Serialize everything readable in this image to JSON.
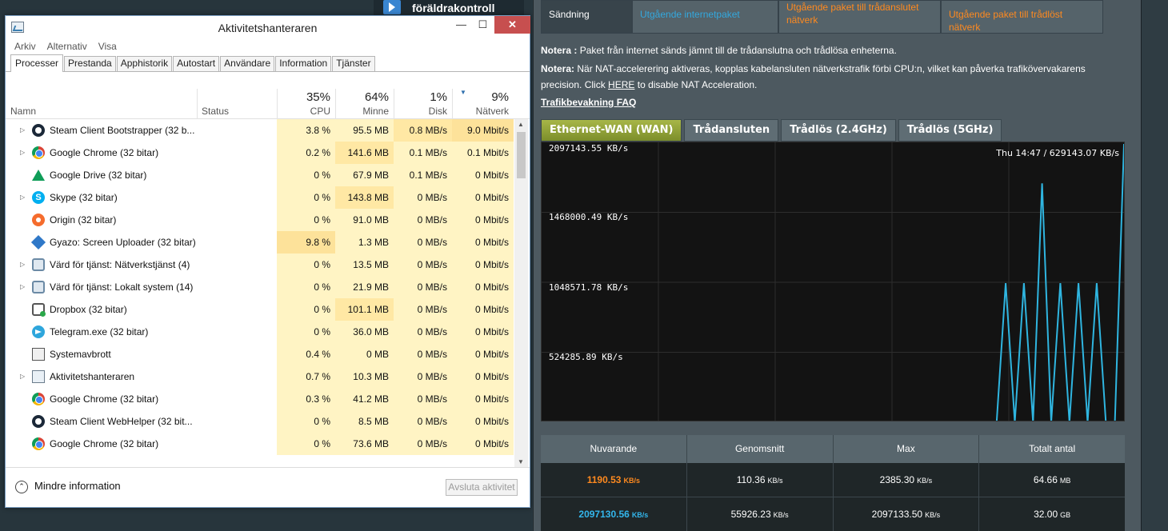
{
  "background_window": {
    "title": "föräldrakontroll"
  },
  "taskmgr": {
    "title": "Aktivitetshanteraren",
    "menu": [
      "Arkiv",
      "Alternativ",
      "Visa"
    ],
    "tabs": [
      "Processer",
      "Prestanda",
      "Apphistorik",
      "Autostart",
      "Användare",
      "Information",
      "Tjänster"
    ],
    "active_tab": "Processer",
    "columns": {
      "name": "Namn",
      "status": "Status",
      "cpu": {
        "pct": "35%",
        "label": "CPU"
      },
      "mem": {
        "pct": "64%",
        "label": "Minne"
      },
      "disk": {
        "pct": "1%",
        "label": "Disk"
      },
      "net": {
        "pct": "9%",
        "label": "Nätverk"
      }
    },
    "rows": [
      {
        "name": "Steam Client Bootstrapper (32 b...",
        "icon": "steam-icon",
        "expand": true,
        "cpu": "3.8 %",
        "mem": "95.5 MB",
        "disk": "0.8 MB/s",
        "net": "9.0 Mbit/s"
      },
      {
        "name": "Google Chrome (32 bitar)",
        "icon": "chrome-icon",
        "expand": true,
        "cpu": "0.2 %",
        "mem": "141.6 MB",
        "disk": "0.1 MB/s",
        "net": "0.1 Mbit/s"
      },
      {
        "name": "Google Drive (32 bitar)",
        "icon": "google-drive-icon",
        "expand": false,
        "cpu": "0 %",
        "mem": "67.9 MB",
        "disk": "0.1 MB/s",
        "net": "0 Mbit/s"
      },
      {
        "name": "Skype (32 bitar)",
        "icon": "skype-icon",
        "expand": true,
        "cpu": "0 %",
        "mem": "143.8 MB",
        "disk": "0 MB/s",
        "net": "0 Mbit/s"
      },
      {
        "name": "Origin (32 bitar)",
        "icon": "origin-icon",
        "expand": false,
        "cpu": "0 %",
        "mem": "91.0 MB",
        "disk": "0 MB/s",
        "net": "0 Mbit/s"
      },
      {
        "name": "Gyazo: Screen Uploader (32 bitar)",
        "icon": "gyazo-icon",
        "expand": false,
        "cpu": "9.8 %",
        "mem": "1.3 MB",
        "disk": "0 MB/s",
        "net": "0 Mbit/s"
      },
      {
        "name": "Värd för tjänst: Nätverkstjänst (4)",
        "icon": "service-host-icon",
        "expand": true,
        "cpu": "0 %",
        "mem": "13.5 MB",
        "disk": "0 MB/s",
        "net": "0 Mbit/s"
      },
      {
        "name": "Värd för tjänst: Lokalt system (14)",
        "icon": "service-host-icon",
        "expand": true,
        "cpu": "0 %",
        "mem": "21.9 MB",
        "disk": "0 MB/s",
        "net": "0 Mbit/s"
      },
      {
        "name": "Dropbox (32 bitar)",
        "icon": "dropbox-icon",
        "expand": false,
        "cpu": "0 %",
        "mem": "101.1 MB",
        "disk": "0 MB/s",
        "net": "0 Mbit/s"
      },
      {
        "name": "Telegram.exe (32 bitar)",
        "icon": "telegram-icon",
        "expand": false,
        "cpu": "0 %",
        "mem": "36.0 MB",
        "disk": "0 MB/s",
        "net": "0 Mbit/s"
      },
      {
        "name": "Systemavbrott",
        "icon": "system-interrupts-icon",
        "expand": false,
        "cpu": "0.4 %",
        "mem": "0 MB",
        "disk": "0 MB/s",
        "net": "0 Mbit/s"
      },
      {
        "name": "Aktivitetshanteraren",
        "icon": "task-manager-icon",
        "expand": true,
        "cpu": "0.7 %",
        "mem": "10.3 MB",
        "disk": "0 MB/s",
        "net": "0 Mbit/s"
      },
      {
        "name": "Google Chrome (32 bitar)",
        "icon": "chrome-icon",
        "expand": false,
        "cpu": "0.3 %",
        "mem": "41.2 MB",
        "disk": "0 MB/s",
        "net": "0 Mbit/s"
      },
      {
        "name": "Steam Client WebHelper (32 bit...",
        "icon": "steam-icon",
        "expand": false,
        "cpu": "0 %",
        "mem": "8.5 MB",
        "disk": "0 MB/s",
        "net": "0 Mbit/s"
      },
      {
        "name": "Google Chrome (32 bitar)",
        "icon": "chrome-icon",
        "expand": false,
        "cpu": "0 %",
        "mem": "73.6 MB",
        "disk": "0 MB/s",
        "net": "0 Mbit/s"
      }
    ],
    "footer": {
      "less_info": "Mindre information",
      "end_task": "Avsluta aktivitet"
    }
  },
  "router": {
    "tabs": [
      "Sändning",
      "Utgående internetpaket",
      "Utgående paket till trådanslutet nätverk",
      "Utgående paket till trådlöst nätverk"
    ],
    "note1_label": "Notera :",
    "note1_text": "Paket från internet sänds jämnt till de trådanslutna och trådlösa enheterna.",
    "note2_label": "Notera:",
    "note2_text": "När NAT-accelerering aktiveras, kopplas kabelansluten nätverkstrafik förbi CPU:n, vilket kan påverka trafikövervakarens precision. Click",
    "note2_link": "HERE",
    "note2_tail": "to disable NAT Acceleration.",
    "faq": "Trafikbevakning FAQ",
    "graph_tabs": [
      "Ethernet-WAN (WAN)",
      "Trådansluten",
      "Trådlös (2.4GHz)",
      "Trådlös (5GHz)"
    ],
    "active_graph_tab": "Ethernet-WAN (WAN)",
    "readout": "Thu 14:47 / 629143.07 KB/s",
    "line_color": "#2fb5e0",
    "stats": {
      "headers": [
        "Nuvarande",
        "Genomsnitt",
        "Max",
        "Totalt antal"
      ],
      "rows": [
        [
          {
            "v": "1190.53",
            "u": "KB/s"
          },
          {
            "v": "110.36",
            "u": "KB/s"
          },
          {
            "v": "2385.30",
            "u": "KB/s"
          },
          {
            "v": "64.66",
            "u": "MB"
          }
        ],
        [
          {
            "v": "2097130.56",
            "u": "KB/s"
          },
          {
            "v": "55926.23",
            "u": "KB/s"
          },
          {
            "v": "2097133.50",
            "u": "KB/s"
          },
          {
            "v": "32.00",
            "u": "GB"
          }
        ]
      ]
    }
  },
  "chart_data": {
    "type": "line",
    "ylabel": "",
    "y_ticks": [
      "2097143.55 KB/s",
      "1468000.49 KB/s",
      "1048571.78 KB/s",
      "524285.89 KB/s"
    ],
    "ylim": [
      0,
      2097143.55
    ],
    "series": [
      {
        "values": [
          0,
          0,
          0,
          0,
          0,
          0,
          0,
          0,
          0,
          0,
          0,
          0,
          0,
          0,
          0,
          0,
          0,
          0,
          0,
          0,
          0,
          0,
          0,
          0,
          0,
          0,
          0,
          0,
          0,
          0,
          0,
          0,
          0,
          0,
          0,
          0,
          0,
          0,
          0,
          0,
          0,
          0,
          0,
          0,
          0,
          0,
          0,
          0,
          0,
          0,
          0,
          1048000,
          0,
          1048000,
          0,
          1800000,
          0,
          1048000,
          0,
          1048000,
          0,
          1048000,
          0,
          0,
          2097130
        ]
      }
    ]
  }
}
